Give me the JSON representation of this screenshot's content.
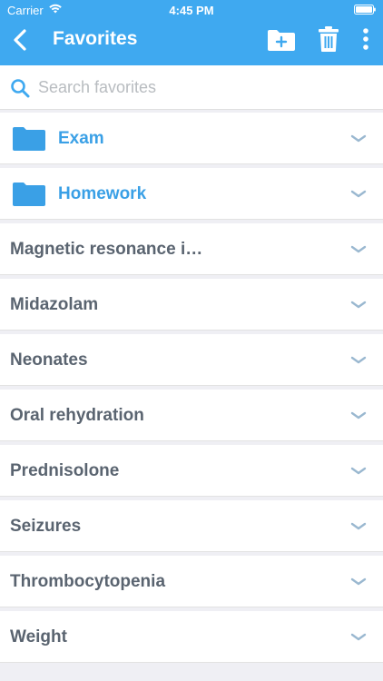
{
  "status_bar": {
    "carrier": "Carrier",
    "time": "4:45 PM"
  },
  "nav": {
    "title": "Favorites",
    "back_icon": "chevron-left-icon",
    "add_folder_icon": "folder-plus-icon",
    "trash_icon": "trash-icon",
    "more_icon": "more-vertical-icon"
  },
  "search": {
    "placeholder": "Search favorites",
    "value": ""
  },
  "folders": [
    {
      "label": "Exam"
    },
    {
      "label": "Homework"
    }
  ],
  "items": [
    {
      "label": "Magnetic resonance i…"
    },
    {
      "label": "Midazolam"
    },
    {
      "label": "Neonates"
    },
    {
      "label": "Oral rehydration"
    },
    {
      "label": "Prednisolone"
    },
    {
      "label": "Seizures"
    },
    {
      "label": "Thrombocytopenia"
    },
    {
      "label": "Weight"
    }
  ],
  "colors": {
    "header": "#3fa9f0",
    "folder": "#3aa0e6",
    "item_text": "#5a6470",
    "chevron": "#9ab8d0"
  }
}
